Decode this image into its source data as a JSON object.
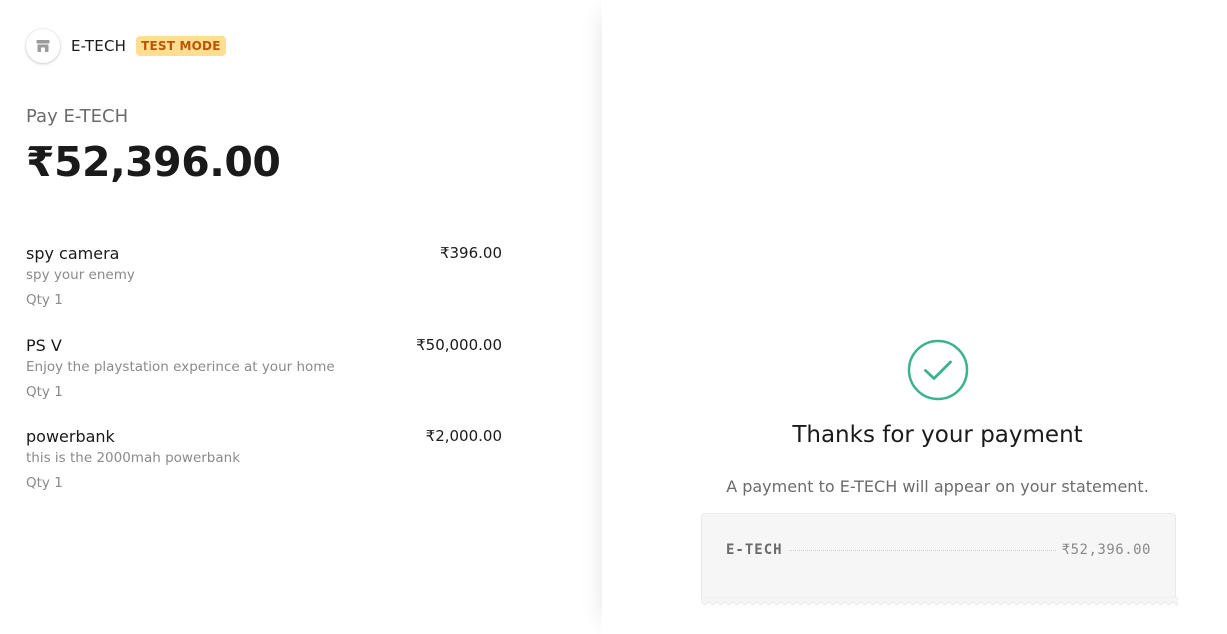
{
  "merchant": {
    "name": "E-TECH",
    "logo_icon": "store-icon",
    "badge": "TEST MODE"
  },
  "summary": {
    "pay_label": "Pay E-TECH",
    "total": "₹52,396.00"
  },
  "line_items": [
    {
      "name": "spy camera",
      "description": "spy your enemy",
      "qty": "Qty 1",
      "price": "₹396.00"
    },
    {
      "name": "PS V",
      "description": "Enjoy the playstation experince at your home",
      "qty": "Qty 1",
      "price": "₹50,000.00"
    },
    {
      "name": "powerbank",
      "description": "this is the 2000mah powerbank",
      "qty": "Qty 1",
      "price": "₹2,000.00"
    }
  ],
  "confirmation": {
    "icon": "checkmark-circle-icon",
    "title": "Thanks for your payment",
    "subtitle": "A payment to E-TECH will appear on your statement.",
    "receipt_merchant": "E-TECH",
    "receipt_total": "₹52,396.00"
  },
  "colors": {
    "success": "#3bb38e",
    "badge_bg": "#ffde92",
    "badge_text": "#bb5504"
  }
}
